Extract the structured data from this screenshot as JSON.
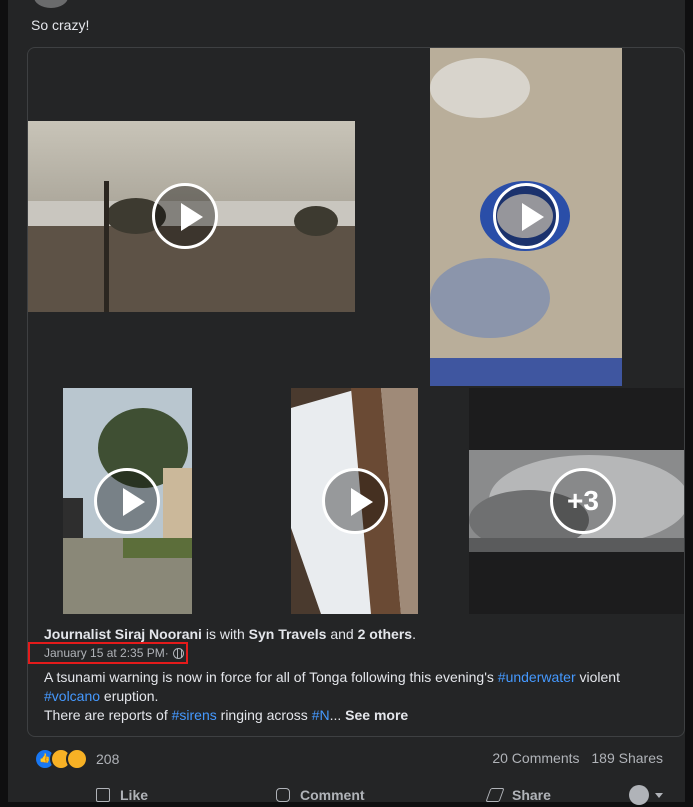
{
  "post": {
    "text": "So crazy!",
    "author": "Journalist Siraj Noorani",
    "with_word": " is with ",
    "tagged": "Syn Travels",
    "and_word": " and ",
    "others": "2 others",
    "period": ".",
    "date": "January 15 at 2:35 PM",
    "date_sep": " ·",
    "desc_p1": "A tsunami warning is now in force for all of Tonga following this evening's ",
    "tag_underwater": "#underwater",
    "desc_p2": " violent",
    "tag_volcano": "#volcano",
    "desc_p3": " eruption.",
    "desc_p4": "There are reports of ",
    "tag_sirens": "#sirens",
    "desc_p5": " ringing across ",
    "tag_n": "#N",
    "ellipsis": "... ",
    "see_more": "See more"
  },
  "media": {
    "more_label": "+3"
  },
  "footer": {
    "reaction_count": "208",
    "comments": "20 Comments",
    "shares": "189 Shares",
    "like": "Like",
    "comment": "Comment",
    "share": "Share"
  },
  "colors": {
    "background": "#242526",
    "link": "#4599ff",
    "highlight_box": "#e41b1b"
  }
}
